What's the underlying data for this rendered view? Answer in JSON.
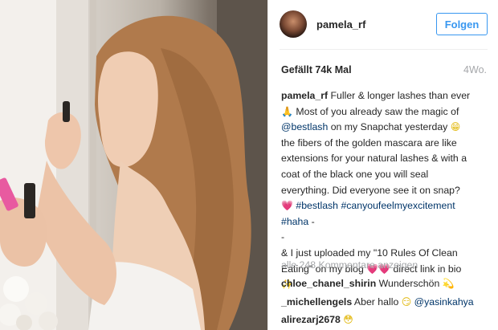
{
  "header": {
    "username": "pamela_rf",
    "follow_label": "Folgen"
  },
  "stats": {
    "likes": "Gefällt 74k Mal",
    "age": "4Wo."
  },
  "caption": {
    "username": "pamela_rf",
    "line1_text": " Fuller & longer lashes than ever",
    "line2_emoji": "🙏",
    "line2_text": " Most of you already saw the magic of",
    "line3_tag": "@bestlash",
    "line3_text": " on my Snapchat yesterday ",
    "line3_emoji": "😁",
    "line4": "the fibers of the golden mascara are like",
    "line5": "extensions for your natural lashes & with a",
    "line6": "coat of the black one you will seal",
    "line7": "everything. Did everyone see it on snap?",
    "line8_emoji": "💗",
    "line8_tag1": "#bestlash",
    "line8_tag2": "#canyoufeelmyexcitement",
    "line9_tag": "#haha",
    "line9_text": " -",
    "line10": "-",
    "line11": "& I just uploaded my \"10 Rules Of Clean",
    "line12_text": "Eating\" on my blog ",
    "line12_emoji": "💗💗",
    "line12_text2": " direct link in bio",
    "line13_emoji": "✨"
  },
  "comments": {
    "view_all": "alle 248 Kommentare anzeigen",
    "items": [
      {
        "user": "chloe_chanel_shirin",
        "text": " Wunderschön ",
        "emoji": "💫",
        "mention": ""
      },
      {
        "user": "_michellengels",
        "text": " Aber hallo ",
        "emoji": "😏",
        "mention": "@yasinkahya"
      },
      {
        "user": "alirezarj2678",
        "text": " ",
        "emoji": "😳",
        "mention": ""
      }
    ]
  },
  "colors": {
    "accent": "#3897f0",
    "tag": "#003569",
    "muted": "#a5a7aa"
  }
}
